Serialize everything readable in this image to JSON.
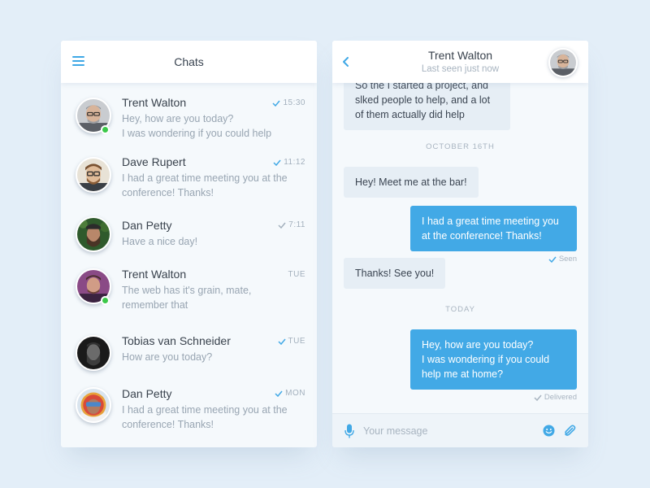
{
  "colors": {
    "accent": "#42a9e6",
    "background": "#e3eef8",
    "panel": "#f5f9fc",
    "online": "#3cc84a",
    "bubble_in": "#e6eef5"
  },
  "chats_panel": {
    "title": "Chats",
    "items": [
      {
        "name": "Trent Walton",
        "preview": "Hey, how are you today?\nI was wondering if you could help",
        "meta": "15:30",
        "read": true,
        "online": true,
        "avatar": "trent-walton-avatar"
      },
      {
        "name": "Dave Rupert",
        "preview": "I had a great time meeting you at the conference! Thanks!",
        "meta": "11:12",
        "read": true,
        "online": false,
        "avatar": "dave-rupert-avatar"
      },
      {
        "name": "Dan Petty",
        "preview": "Have a nice day!",
        "meta": "7:11",
        "read": true,
        "online": false,
        "avatar": "dan-petty-avatar"
      },
      {
        "name": "Trent Walton",
        "preview": "The web has it's grain, mate, remember that",
        "meta": "TUE",
        "read": false,
        "online": true,
        "avatar": "trent-walton-purple-avatar"
      },
      {
        "name": "Tobias van Schneider",
        "preview": "How are you today?",
        "meta": "TUE",
        "read": true,
        "online": false,
        "avatar": "tobias-avatar"
      },
      {
        "name": "Dan Petty",
        "preview": "I had a great time meeting you at the conference! Thanks!",
        "meta": "MON",
        "read": true,
        "online": false,
        "avatar": "dan-petty-helmet-avatar"
      }
    ]
  },
  "conversation": {
    "contact_name": "Trent Walton",
    "status": "Last seen just now",
    "messages": [
      {
        "type": "in",
        "text": "So the I started a project, and slked people to help, and a lot of them actually did help"
      },
      {
        "type": "date",
        "text": "OCTOBER 16TH"
      },
      {
        "type": "in",
        "text": "Hey! Meet me at the bar!"
      },
      {
        "type": "out",
        "text": "I had a great time meeting you at the conference! Thanks!",
        "receipt": "Seen"
      },
      {
        "type": "in",
        "text": "Thanks! See you!"
      },
      {
        "type": "date",
        "text": "TODAY"
      },
      {
        "type": "out",
        "text": "Hey, how are you today?\nI was wondering if you could help me at home?",
        "receipt": "Delivered"
      }
    ],
    "composer": {
      "placeholder": "Your message"
    }
  }
}
